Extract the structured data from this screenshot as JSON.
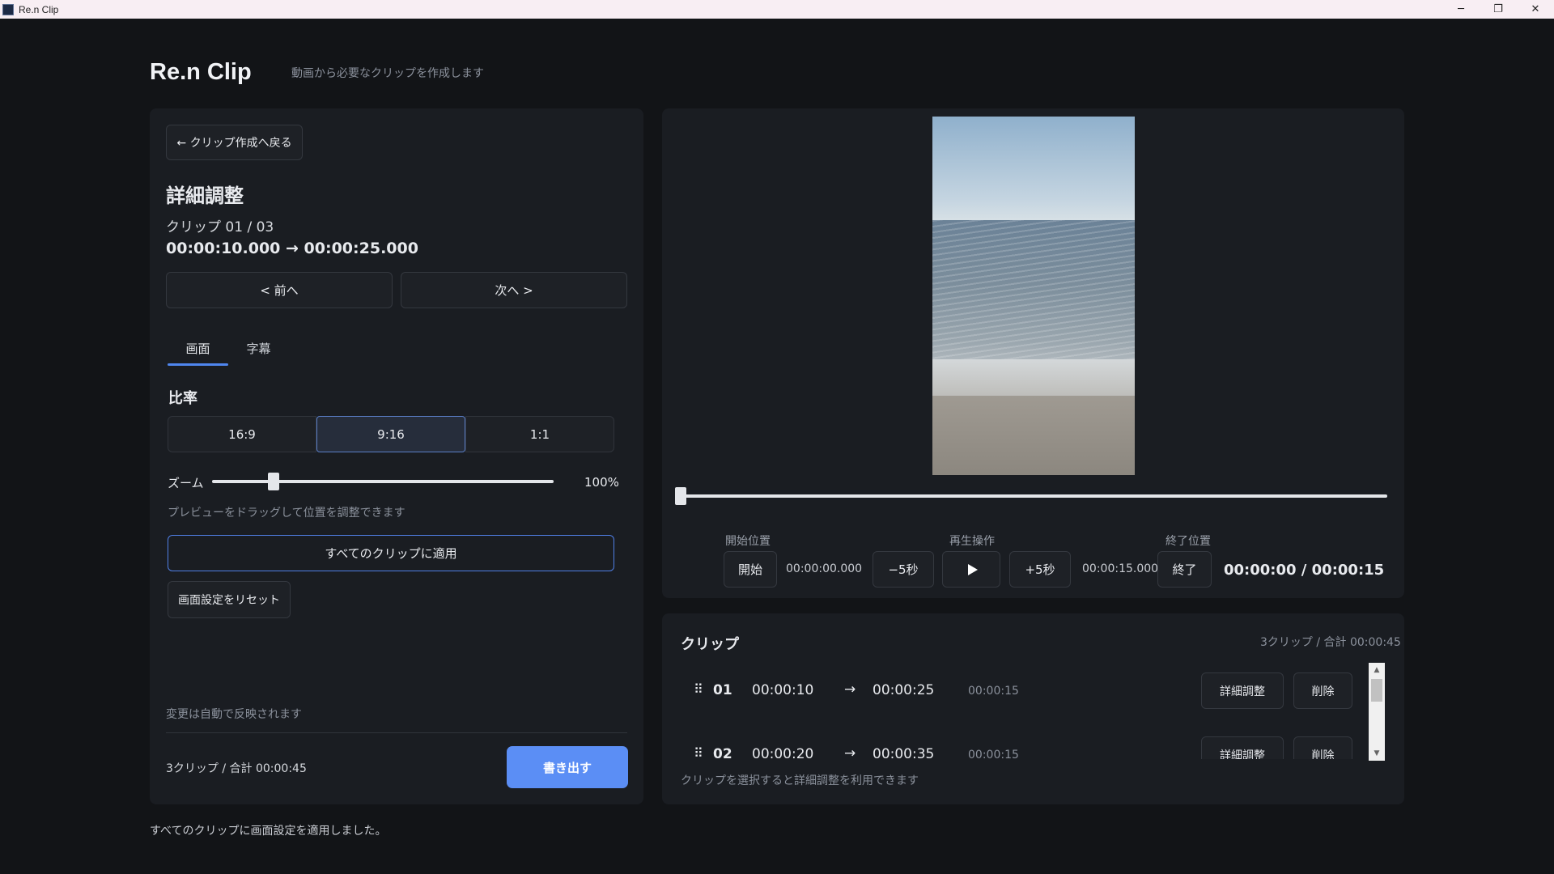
{
  "window": {
    "title": "Re.n Clip",
    "controls": {
      "minimize": "─",
      "restore": "❐",
      "close": "✕"
    }
  },
  "header": {
    "title": "Re.n Clip",
    "subtitle": "動画から必要なクリップを作成します"
  },
  "left": {
    "back_label": "← クリップ作成へ戻る",
    "heading": "詳細調整",
    "clip_counter": "クリップ 01 / 03",
    "clip_range": "00:00:10.000 → 00:00:25.000",
    "prev_label": "< 前へ",
    "next_label": "次へ >",
    "tabs": [
      "画面",
      "字幕"
    ],
    "active_tab": "画面",
    "ratio": {
      "label": "比率",
      "options": [
        "16:9",
        "9:16",
        "1:1"
      ],
      "selected": "9:16"
    },
    "zoom": {
      "label": "ズーム",
      "value_text": "100%",
      "slider_fraction": 0.17
    },
    "drag_hint": "プレビューをドラッグして位置を調整できます",
    "apply_all_label": "すべてのクリップに適用",
    "reset_label": "画面設定をリセット",
    "auto_note": "変更は自動で反映されます",
    "summary": "3クリップ / 合計 00:00:45",
    "export_label": "書き出す"
  },
  "preview": {
    "seek_fraction": 0.0,
    "start_label": "開始位置",
    "playback_label": "再生操作",
    "end_label": "終了位置",
    "start_btn": "開始",
    "start_time": "00:00:00.000",
    "back5_btn": "−5秒",
    "play_icon": "play-icon",
    "fwd5_btn": "+5秒",
    "end_time": "00:00:15.000",
    "end_btn": "終了",
    "current_total": "00:00:00 / 00:00:15"
  },
  "clips": {
    "title": "クリップ",
    "summary": "3クリップ / 合計 00:00:45",
    "rows": [
      {
        "num": "01",
        "start": "00:00:10",
        "arrow": "→",
        "end": "00:00:25",
        "duration": "00:00:15",
        "detail": "詳細調整",
        "delete": "削除"
      },
      {
        "num": "02",
        "start": "00:00:20",
        "arrow": "→",
        "end": "00:00:35",
        "duration": "00:00:15",
        "detail": "詳細調整",
        "delete": "削除"
      }
    ],
    "hint": "クリップを選択すると詳細調整を利用できます"
  },
  "status_message": "すべてのクリップに画面設定を適用しました。",
  "colors": {
    "accent": "#5b8ef5",
    "background": "#121417",
    "panel": "#1a1d22"
  }
}
